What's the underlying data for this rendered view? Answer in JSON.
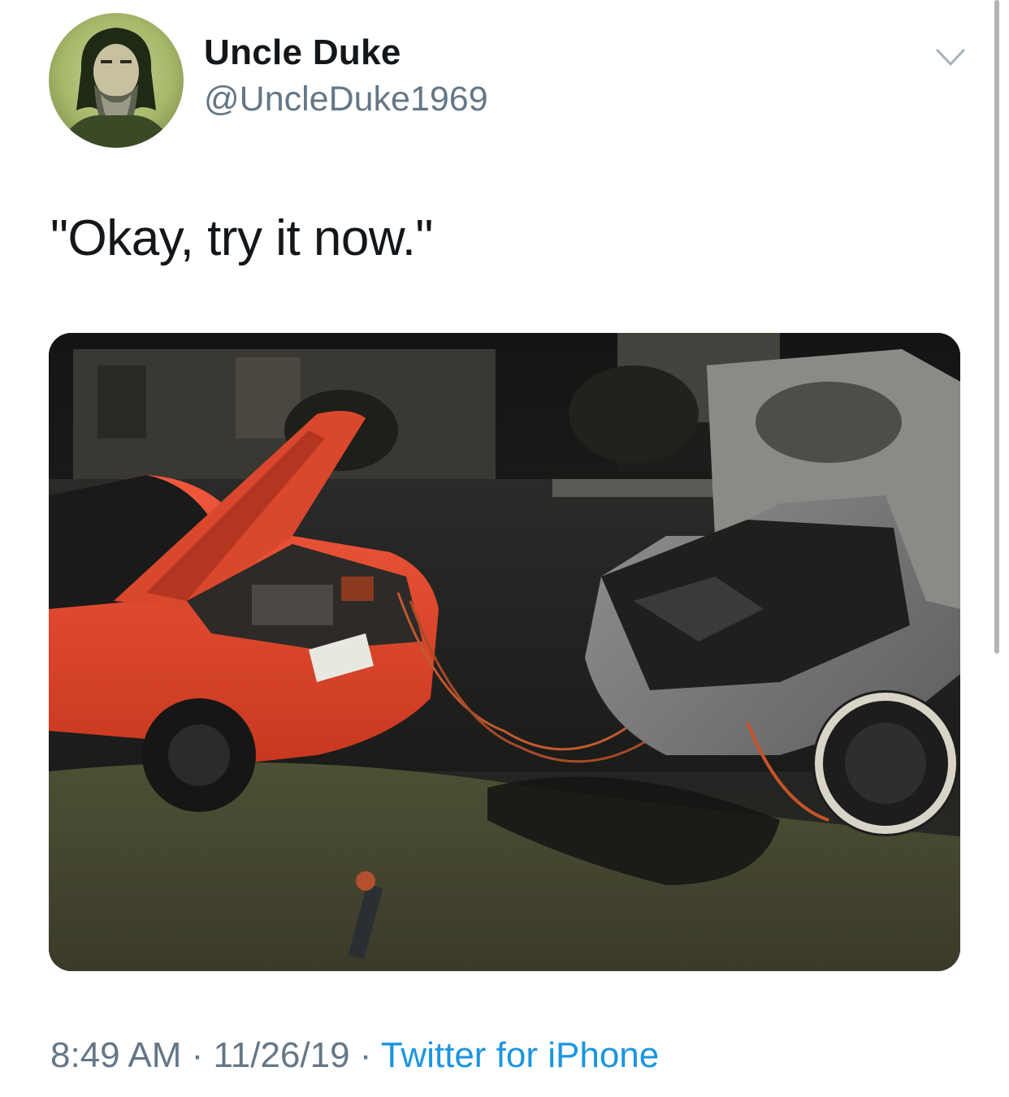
{
  "author": {
    "display_name": "Uncle Duke",
    "handle": "@UncleDuke1969",
    "avatar_icon": "bearded-man-avatar"
  },
  "tweet": {
    "text": "\"Okay, try it now.\"",
    "media_icon": "photo-red-car-jump-starting-burned-car"
  },
  "meta": {
    "time": "8:49 AM",
    "separator": " · ",
    "date": "11/26/19",
    "source": "Twitter for iPhone"
  },
  "controls": {
    "menu_icon": "chevron-down-icon"
  },
  "colors": {
    "text": "#14171a",
    "secondary": "#657786",
    "link": "#1b95e0",
    "background": "#ffffff"
  }
}
